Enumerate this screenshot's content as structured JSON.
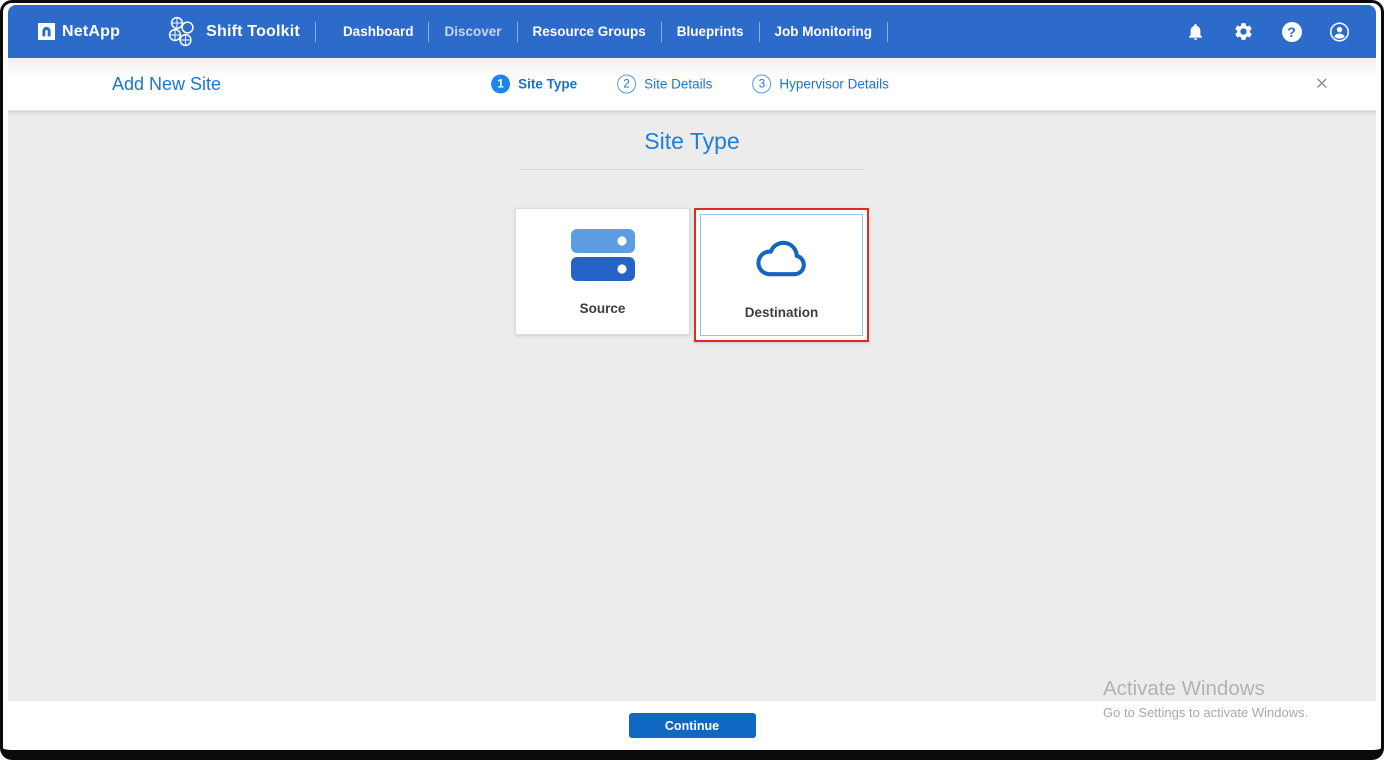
{
  "navbar": {
    "brand_name": "NetApp",
    "product_name": "Shift Toolkit",
    "items": [
      {
        "label": "Dashboard",
        "dim": false
      },
      {
        "label": "Discover",
        "dim": true
      },
      {
        "label": "Resource Groups",
        "dim": false
      },
      {
        "label": "Blueprints",
        "dim": false
      },
      {
        "label": "Job Monitoring",
        "dim": false
      }
    ],
    "icons": [
      "bell-icon",
      "gear-icon",
      "help-icon",
      "account-icon"
    ],
    "help_glyph": "?"
  },
  "wizard": {
    "title": "Add New Site",
    "close_glyph": "×",
    "steps": [
      {
        "number": "1",
        "label": "Site Type",
        "active": true
      },
      {
        "number": "2",
        "label": "Site Details",
        "active": false
      },
      {
        "number": "3",
        "label": "Hypervisor Details",
        "active": false
      }
    ]
  },
  "main": {
    "heading": "Site Type",
    "cards": [
      {
        "label": "Source",
        "icon": "server-icon",
        "selected": false
      },
      {
        "label": "Destination",
        "icon": "cloud-icon",
        "selected": true
      }
    ]
  },
  "footer": {
    "continue_label": "Continue"
  },
  "watermark": {
    "line1": "Activate Windows",
    "line2": "Go to Settings to activate Windows."
  },
  "colors": {
    "navbar_blue": "#2d6bcb",
    "accent_blue": "#1a76d2",
    "step_active_blue": "#1d86ea",
    "heading_blue": "#1e80d9",
    "button_blue": "#1068c2",
    "selected_red": "#e02b20",
    "inner_border_blue": "#9cc0ee",
    "cloud_blue": "#1565c0",
    "server_bar_light": "#5d9de4",
    "server_bar_dark": "#2563c9",
    "content_gray": "#ececec"
  }
}
